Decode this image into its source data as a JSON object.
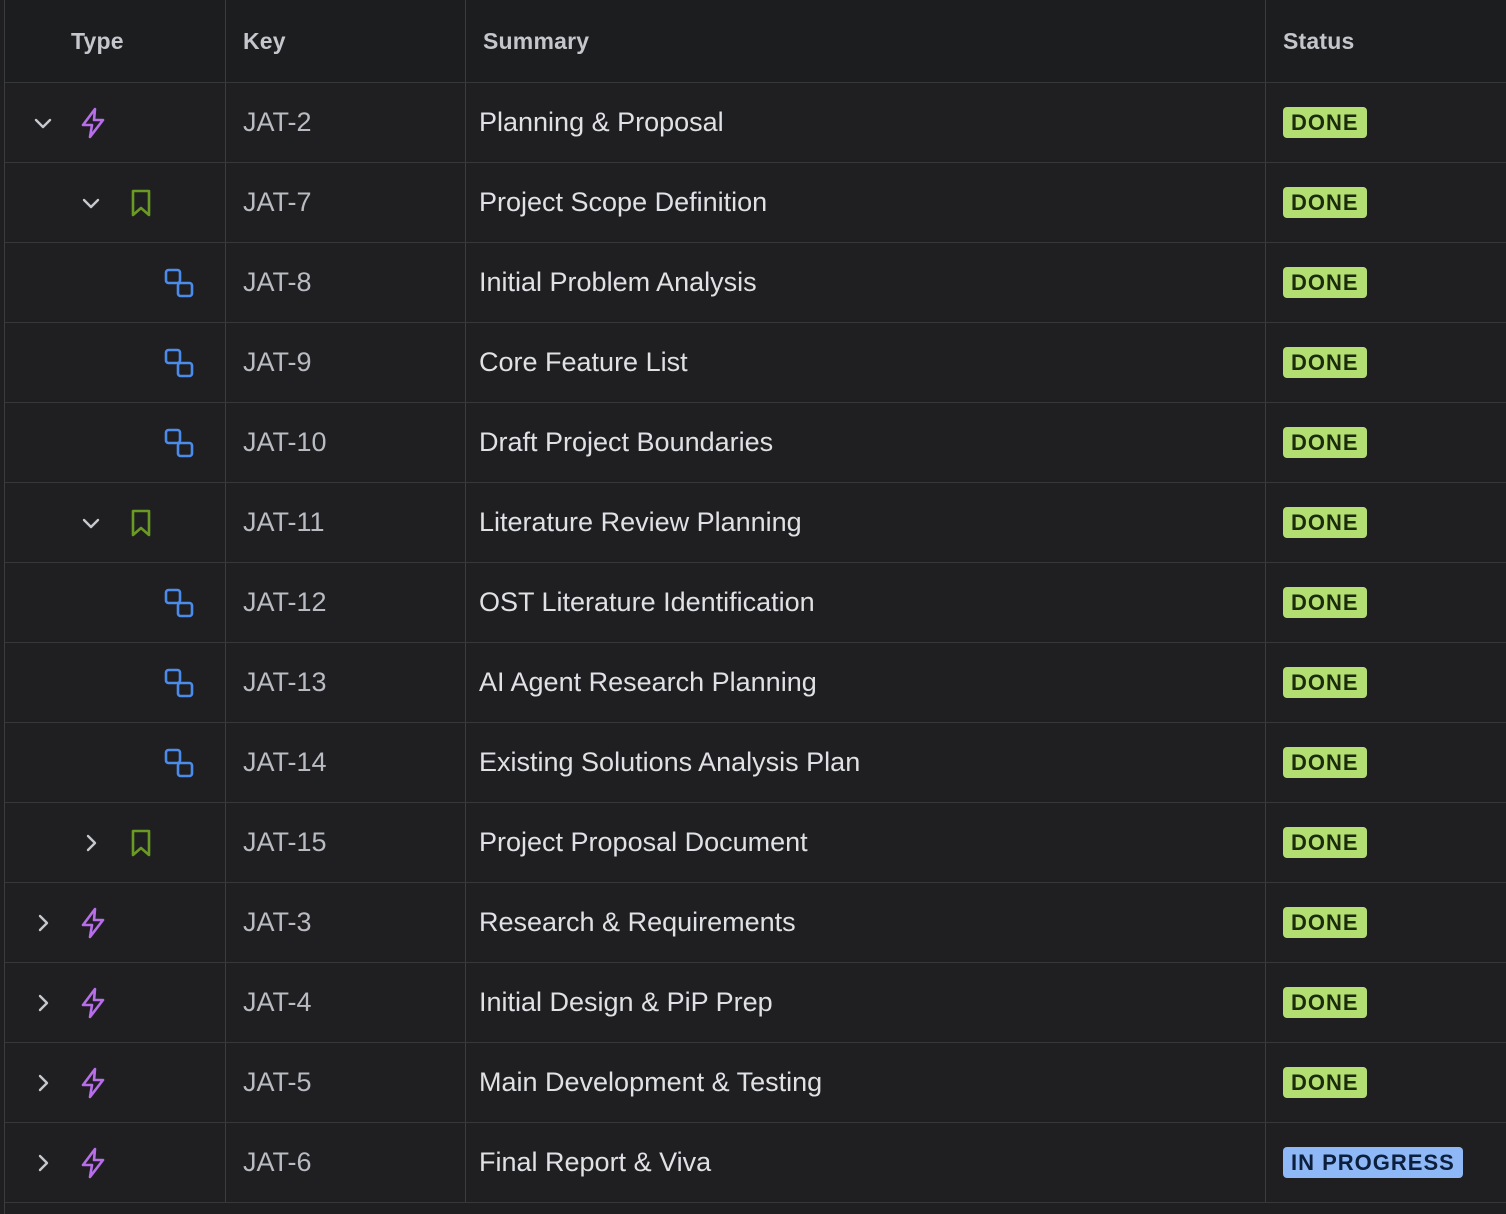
{
  "header": {
    "type": "Type",
    "key": "Key",
    "summary": "Summary",
    "status": "Status"
  },
  "colors": {
    "epic": "#b76ee8",
    "story": "#6a9a23",
    "subtask": "#4b8bea",
    "done_bg": "#b3df72",
    "in_progress_bg": "#8fb8f6"
  },
  "rows": [
    {
      "level": 0,
      "expander": "expanded",
      "type_icon": "lightning-icon",
      "key": "JAT-2",
      "summary": "Planning & Proposal",
      "status": "DONE"
    },
    {
      "level": 1,
      "expander": "expanded",
      "type_icon": "bookmark-icon",
      "key": "JAT-7",
      "summary": "Project Scope Definition",
      "status": "DONE"
    },
    {
      "level": 2,
      "expander": "none",
      "type_icon": "subtask-icon",
      "key": "JAT-8",
      "summary": "Initial Problem Analysis",
      "status": "DONE"
    },
    {
      "level": 2,
      "expander": "none",
      "type_icon": "subtask-icon",
      "key": "JAT-9",
      "summary": "Core Feature List",
      "status": "DONE"
    },
    {
      "level": 2,
      "expander": "none",
      "type_icon": "subtask-icon",
      "key": "JAT-10",
      "summary": "Draft Project Boundaries",
      "status": "DONE"
    },
    {
      "level": 1,
      "expander": "expanded",
      "type_icon": "bookmark-icon",
      "key": "JAT-11",
      "summary": "Literature Review Planning",
      "status": "DONE"
    },
    {
      "level": 2,
      "expander": "none",
      "type_icon": "subtask-icon",
      "key": "JAT-12",
      "summary": "OST Literature Identification",
      "status": "DONE"
    },
    {
      "level": 2,
      "expander": "none",
      "type_icon": "subtask-icon",
      "key": "JAT-13",
      "summary": "AI Agent Research Planning",
      "status": "DONE"
    },
    {
      "level": 2,
      "expander": "none",
      "type_icon": "subtask-icon",
      "key": "JAT-14",
      "summary": "Existing Solutions Analysis Plan",
      "status": "DONE"
    },
    {
      "level": 1,
      "expander": "collapsed",
      "type_icon": "bookmark-icon",
      "key": "JAT-15",
      "summary": "Project Proposal Document",
      "status": "DONE"
    },
    {
      "level": 0,
      "expander": "collapsed",
      "type_icon": "lightning-icon",
      "key": "JAT-3",
      "summary": "Research & Requirements",
      "status": "DONE"
    },
    {
      "level": 0,
      "expander": "collapsed",
      "type_icon": "lightning-icon",
      "key": "JAT-4",
      "summary": "Initial Design & PiP Prep",
      "status": "DONE"
    },
    {
      "level": 0,
      "expander": "collapsed",
      "type_icon": "lightning-icon",
      "key": "JAT-5",
      "summary": "Main Development & Testing",
      "status": "DONE"
    },
    {
      "level": 0,
      "expander": "collapsed",
      "type_icon": "lightning-icon",
      "key": "JAT-6",
      "summary": "Final Report & Viva",
      "status": "IN PROGRESS"
    }
  ]
}
